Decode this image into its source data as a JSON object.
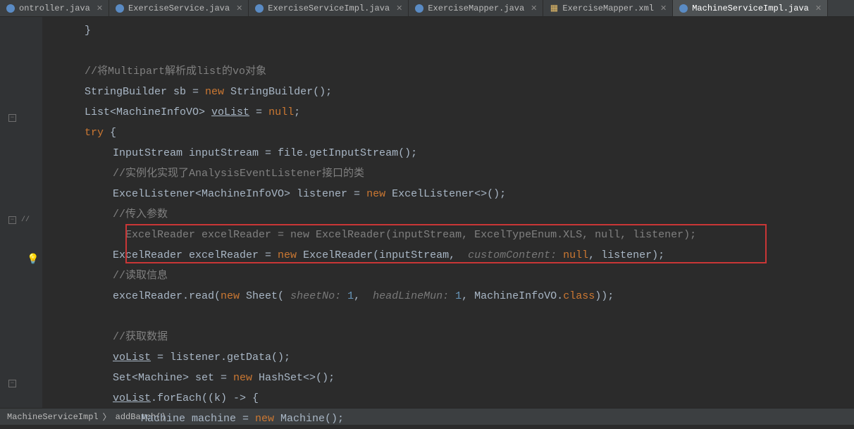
{
  "tabs": [
    {
      "label": "ontroller.java",
      "iconColor": "#5a8bc4",
      "active": false
    },
    {
      "label": "ExerciseService.java",
      "iconColor": "#5a8bc4",
      "active": false
    },
    {
      "label": "ExerciseServiceImpl.java",
      "iconColor": "#5a8bc4",
      "active": false
    },
    {
      "label": "ExerciseMapper.java",
      "iconColor": "#5a8bc4",
      "active": false
    },
    {
      "label": "ExerciseMapper.xml",
      "iconColor": "#e8bf6a",
      "active": false
    },
    {
      "label": "MachineServiceImpl.java",
      "iconColor": "#5a8bc4",
      "active": true
    }
  ],
  "breadcrumb": {
    "class": "MachineServiceImpl",
    "method": "addBatch()",
    "sep": "〉"
  },
  "code": {
    "l0": "}",
    "c1": "//将Multipart解析成list的vo对象",
    "l2_a": "StringBuilder sb = ",
    "l2_b": "new",
    "l2_c": " StringBuilder();",
    "l3_a": "List<MachineInfoVO> ",
    "l3_b": "voList",
    "l3_c": " = ",
    "l3_d": "null",
    "l3_e": ";",
    "l4_a": "try",
    "l4_b": " {",
    "l5_a": "InputStream inputStream = file.getInputStream();",
    "c6": "//实例化实现了AnalysisEventListener接口的类",
    "l7_a": "ExcelListener<MachineInfoVO> listener = ",
    "l7_b": "new",
    "l7_c": " ExcelListener<>();",
    "c8": "//传入参数",
    "l9_a": "  ExcelReader excelReader = new ExcelReader(inputStream, ExcelTypeEnum.XLS, null, listener);",
    "l10_a": "ExcelReader excelReader = ",
    "l10_b": "new",
    "l10_c": " ExcelReader(inputStream, ",
    "l10_hint": " customContent: ",
    "l10_d": "null",
    "l10_e": ", listener);",
    "c11": "//读取信息",
    "l12_a": "excelReader.read(",
    "l12_b": "new",
    "l12_c": " Sheet(",
    "l12_h1": " sheetNo: ",
    "l12_n1": "1",
    "l12_s1": ", ",
    "l12_h2": " headLineMun: ",
    "l12_n2": "1",
    "l12_s2": ", MachineInfoVO.",
    "l12_cls": "class",
    "l12_e": "));",
    "c13": "//获取数据",
    "l14_a": "voList",
    "l14_b": " = listener.getData();",
    "l15_a": "Set<Machine> set = ",
    "l15_b": "new",
    "l15_c": " HashSet<>();",
    "l16_a": "voList",
    "l16_b": ".forEach((k) -> {",
    "l17_a": "Machine machine = ",
    "l17_b": "new",
    "l17_c": " Machine();"
  },
  "gutter_comment": "//"
}
